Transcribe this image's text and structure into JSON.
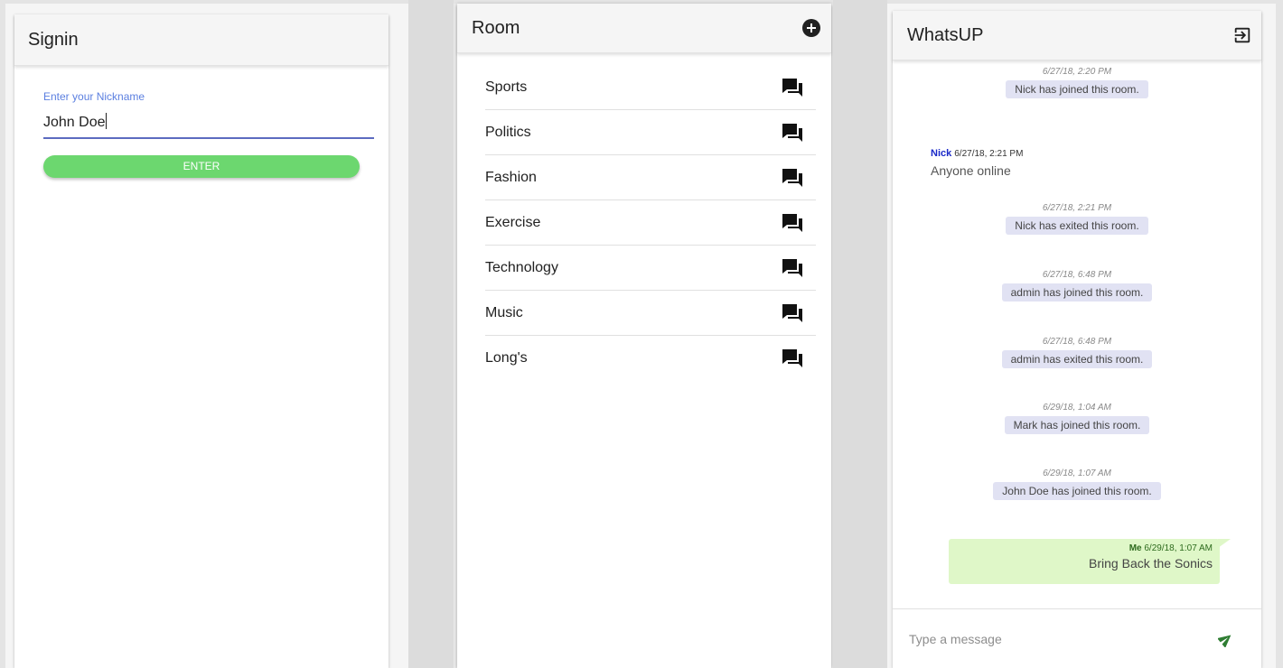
{
  "signin": {
    "title": "Signin",
    "nickname_label": "Enter your Nickname",
    "nickname_value": "John Doe",
    "enter_label": "ENTER"
  },
  "rooms": {
    "title": "Room",
    "add_icon": "add-circle-icon",
    "items": [
      {
        "name": "Sports",
        "icon": "chat-icon"
      },
      {
        "name": "Politics",
        "icon": "chat-icon"
      },
      {
        "name": "Fashion",
        "icon": "chat-icon"
      },
      {
        "name": "Exercise",
        "icon": "chat-icon"
      },
      {
        "name": "Technology",
        "icon": "chat-icon"
      },
      {
        "name": "Music",
        "icon": "chat-icon"
      },
      {
        "name": "Long's",
        "icon": "chat-icon"
      }
    ]
  },
  "chat": {
    "title": "WhatsUP",
    "exit_icon": "exit-icon",
    "system_messages": [
      {
        "time": "6/27/18, 2:20 PM",
        "text": "Nick has joined this room."
      },
      {
        "time": "6/27/18, 2:21 PM",
        "text": "Nick has exited this room."
      },
      {
        "time": "6/27/18, 6:48 PM",
        "text": "admin has joined this room."
      },
      {
        "time": "6/27/18, 6:48 PM",
        "text": "admin has exited this room."
      },
      {
        "time": "6/29/18, 1:04 AM",
        "text": "Mark has joined this room."
      },
      {
        "time": "6/29/18, 1:07 AM",
        "text": "John Doe has joined this room."
      }
    ],
    "incoming": {
      "author": "Nick",
      "time": "6/27/18, 2:21 PM",
      "text": "Anyone online"
    },
    "outgoing": {
      "author": "Me",
      "time": "6/29/18, 1:07 AM",
      "text": "Bring Back the Sonics"
    },
    "composer_placeholder": "Type a message",
    "send_icon": "send-icon"
  },
  "colors": {
    "enter_button": "#6cd76f",
    "input_underline": "#5c6bc0",
    "label_blue": "#5b7fe0",
    "system_bubble": "#e1e2f3",
    "outgoing_bubble": "#dff7c8",
    "author_blue": "#1a29c8"
  }
}
